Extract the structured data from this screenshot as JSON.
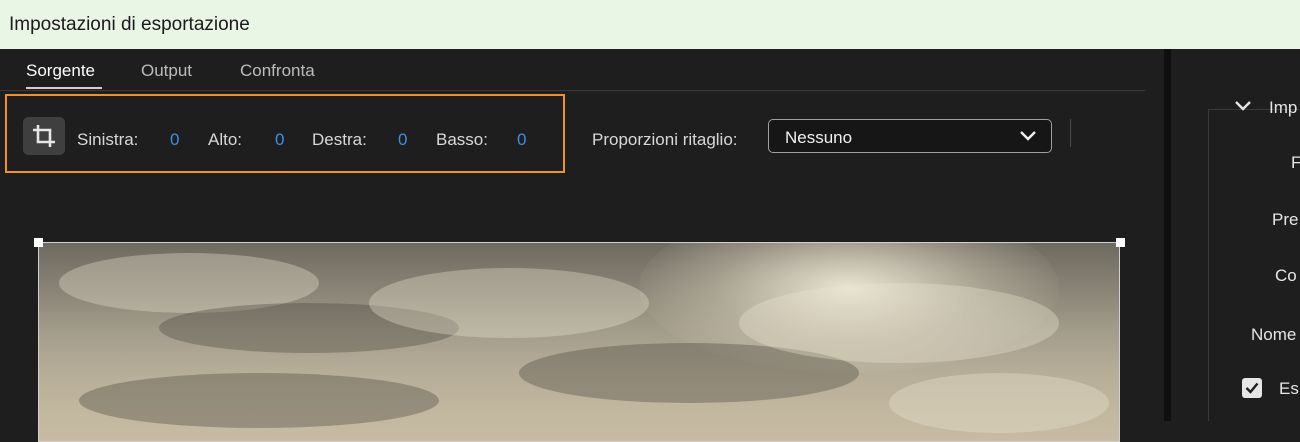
{
  "window": {
    "title": "Impostazioni di esportazione"
  },
  "tabs": [
    {
      "label": "Sorgente",
      "active": true
    },
    {
      "label": "Output",
      "active": false
    },
    {
      "label": "Confronta",
      "active": false
    }
  ],
  "crop": {
    "tool_icon": "crop-icon",
    "fields": [
      {
        "label": "Sinistra:",
        "value": "0"
      },
      {
        "label": "Alto:",
        "value": "0"
      },
      {
        "label": "Destra:",
        "value": "0"
      },
      {
        "label": "Basso:",
        "value": "0"
      }
    ]
  },
  "crop_ratio": {
    "label": "Proporzioni ritaglio:",
    "selected": "Nessuno"
  },
  "right_panel": {
    "section_title": "Imp",
    "rows": [
      "F",
      "Pre",
      "Co",
      "Nome"
    ],
    "checkbox_label": "Esp",
    "checkbox_checked": true
  },
  "colors": {
    "accent": "#3f8de8",
    "highlight": "#f0912a",
    "titlebar": "#e9f6e6"
  }
}
